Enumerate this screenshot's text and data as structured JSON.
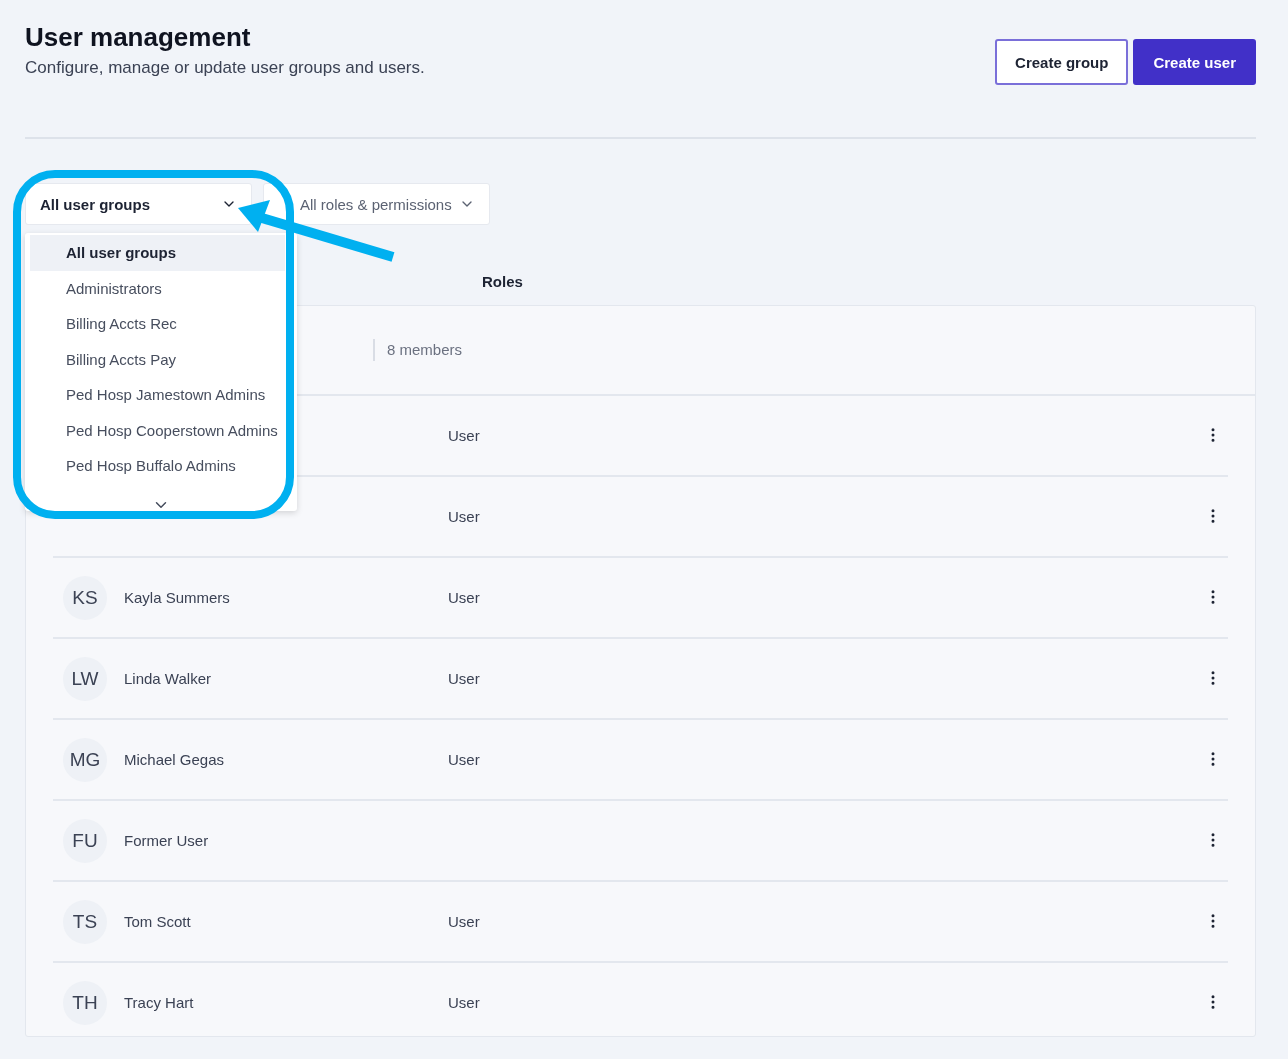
{
  "header": {
    "title": "User management",
    "subtitle": "Configure, manage or update user groups and users."
  },
  "actions": [
    {
      "label": "Create group",
      "kind": "secondary"
    },
    {
      "label": "Create user",
      "kind": "primary"
    }
  ],
  "filters": [
    {
      "label": "All user groups",
      "expanded": true
    },
    {
      "label": "All roles & permissions",
      "expanded": false
    }
  ],
  "group_dropdown": {
    "items": [
      {
        "label": "All user groups",
        "selected": true
      },
      {
        "label": "Administrators",
        "selected": false
      },
      {
        "label": "Billing Accts Rec",
        "selected": false
      },
      {
        "label": "Billing Accts Pay",
        "selected": false
      },
      {
        "label": "Ped Hosp Jamestown Admins",
        "selected": false
      },
      {
        "label": "Ped Hosp Cooperstown Admins",
        "selected": false
      },
      {
        "label": "Ped Hosp Buffalo Admins",
        "selected": false
      }
    ]
  },
  "table": {
    "columns": [
      "Roles"
    ],
    "group_row": {
      "members": "8 members"
    },
    "rows": [
      {
        "role": "User"
      },
      {
        "role": "User"
      },
      {
        "initials": "KS",
        "name": "Kayla Summers",
        "role": "User"
      },
      {
        "initials": "LW",
        "name": "Linda Walker",
        "role": "User"
      },
      {
        "initials": "MG",
        "name": "Michael Gegas",
        "role": "User"
      },
      {
        "initials": "FU",
        "name": "Former User"
      },
      {
        "initials": "TS",
        "name": "Tom Scott",
        "role": "User"
      },
      {
        "initials": "TH",
        "name": "Tracy Hart",
        "role": "User"
      }
    ]
  }
}
